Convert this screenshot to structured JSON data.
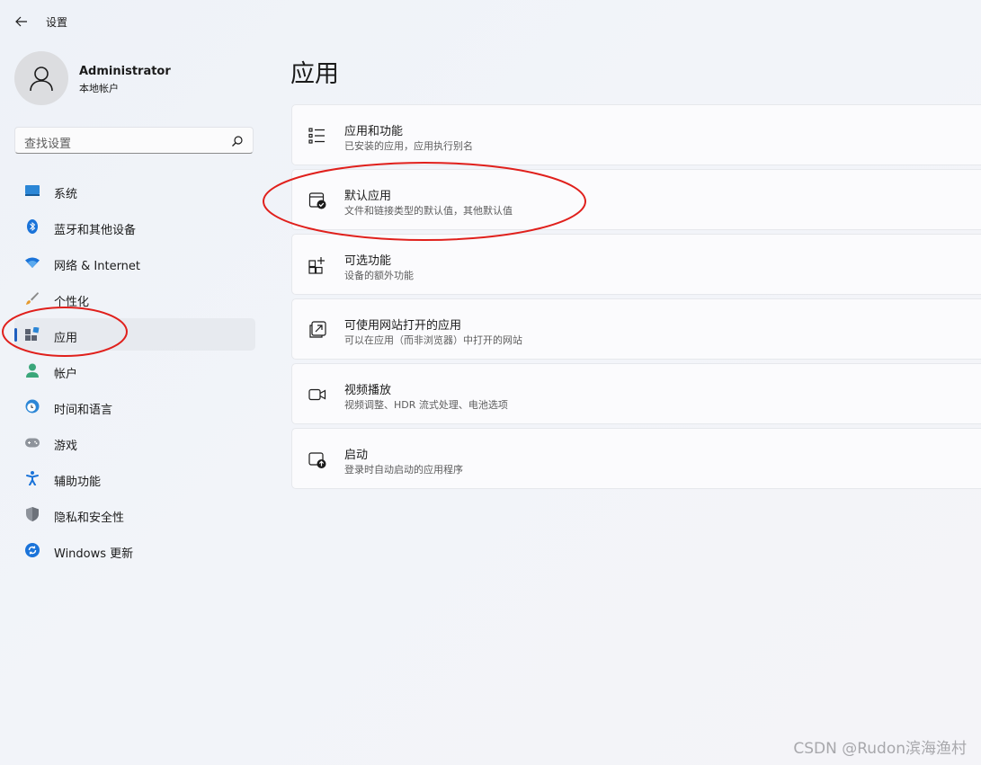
{
  "window": {
    "title": "设置"
  },
  "user": {
    "name": "Administrator",
    "account_type": "本地帐户"
  },
  "search": {
    "placeholder": "查找设置"
  },
  "nav": {
    "items": [
      {
        "label": "系统",
        "icon": "system-icon",
        "active": false
      },
      {
        "label": "蓝牙和其他设备",
        "icon": "bluetooth-icon",
        "active": false
      },
      {
        "label": "网络 & Internet",
        "icon": "wifi-icon",
        "active": false
      },
      {
        "label": "个性化",
        "icon": "brush-icon",
        "active": false
      },
      {
        "label": "应用",
        "icon": "apps-icon",
        "active": true
      },
      {
        "label": "帐户",
        "icon": "person-icon",
        "active": false
      },
      {
        "label": "时间和语言",
        "icon": "globe-clock-icon",
        "active": false
      },
      {
        "label": "游戏",
        "icon": "gamepad-icon",
        "active": false
      },
      {
        "label": "辅助功能",
        "icon": "accessibility-icon",
        "active": false
      },
      {
        "label": "隐私和安全性",
        "icon": "shield-icon",
        "active": false
      },
      {
        "label": "Windows 更新",
        "icon": "update-icon",
        "active": false
      }
    ]
  },
  "main": {
    "title": "应用",
    "cards": [
      {
        "title": "应用和功能",
        "subtitle": "已安装的应用，应用执行别名",
        "icon": "list-icon"
      },
      {
        "title": "默认应用",
        "subtitle": "文件和链接类型的默认值，其他默认值",
        "icon": "default-apps-icon"
      },
      {
        "title": "可选功能",
        "subtitle": "设备的额外功能",
        "icon": "optional-features-icon"
      },
      {
        "title": "可使用网站打开的应用",
        "subtitle": "可以在应用（而非浏览器）中打开的网站",
        "icon": "open-external-icon"
      },
      {
        "title": "视频播放",
        "subtitle": "视频调整、HDR 流式处理、电池选项",
        "icon": "video-icon"
      },
      {
        "title": "启动",
        "subtitle": "登录时自动启动的应用程序",
        "icon": "startup-icon"
      }
    ]
  },
  "watermark": "CSDN @Rudon滨海渔村",
  "colors": {
    "accent": "#1f5fbf",
    "annotation": "#e0201c"
  }
}
